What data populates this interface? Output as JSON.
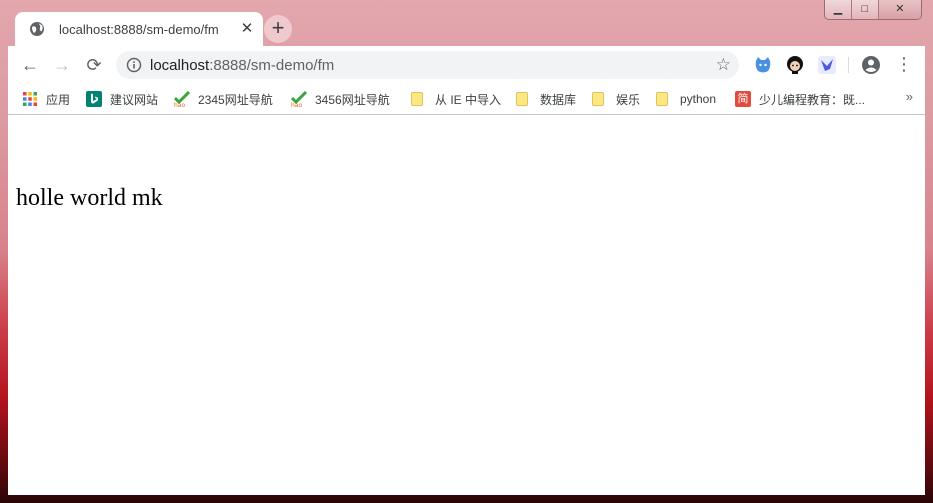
{
  "tab": {
    "title": "localhost:8888/sm-demo/fm",
    "close_glyph": "✕",
    "icon": "globe-icon"
  },
  "new_tab_glyph": "+",
  "window_controls": {
    "minimize": "▁",
    "maximize": "□",
    "close": "✕"
  },
  "toolbar": {
    "back": "←",
    "forward": "→",
    "reload": "⟳",
    "url_host": "localhost",
    "url_path": ":8888/sm-demo/fm",
    "star": "☆",
    "menu": "⋮"
  },
  "bookmarks": [
    {
      "label": "应用",
      "icon": "apps-grid-icon"
    },
    {
      "label": "建议网站",
      "icon": "bing-icon"
    },
    {
      "label": "2345网址导航",
      "icon": "hao-icon"
    },
    {
      "label": "3456网址导航",
      "icon": "hao-icon"
    },
    {
      "label": "从 IE 中导入",
      "icon": "folder-icon"
    },
    {
      "label": "数据库",
      "icon": "folder-icon"
    },
    {
      "label": "娱乐",
      "icon": "folder-icon"
    },
    {
      "label": "python",
      "icon": "folder-icon"
    },
    {
      "label": "少儿编程教育：既...",
      "icon": "jian-icon"
    }
  ],
  "bookmarks_overflow": "»",
  "jian_glyph": "简",
  "content": {
    "text": "holle world mk"
  },
  "colors": {
    "accent": "#1a73e8",
    "frame": "#dc9aa1"
  }
}
